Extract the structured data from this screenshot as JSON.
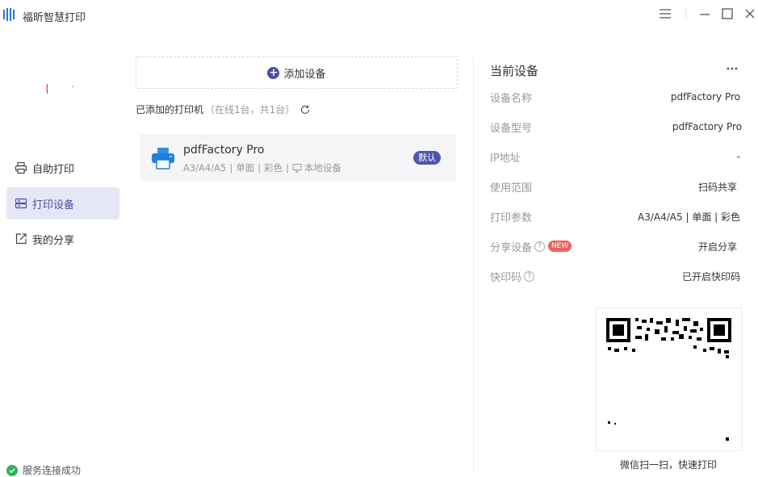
{
  "app": {
    "title": "福昕智慧打印",
    "brand_color": "#2b6fe0",
    "accent": "#4a4ea8"
  },
  "sidebar": {
    "items": [
      {
        "label": "自助打印",
        "icon": "printer-icon",
        "active": false
      },
      {
        "label": "打印设备",
        "icon": "device-icon",
        "active": true
      },
      {
        "label": "我的分享",
        "icon": "share-icon",
        "active": false
      }
    ],
    "status": "服务连接成功",
    "status_color": "#35b35b"
  },
  "main": {
    "add_device_label": "添加设备",
    "added_title": "已添加的打印机",
    "added_sub": "（在线1台，共1台）",
    "printers": [
      {
        "name": "pdfFactory Pro",
        "sizes": "A3/A4/A5",
        "sep1": "|",
        "duplex": "单面",
        "sep2": "|",
        "color": "彩色",
        "sep3": "|",
        "location": "本地设备",
        "badge": "默认"
      }
    ]
  },
  "current_device": {
    "title": "当前设备",
    "fields": [
      {
        "key": "设备名称",
        "value": "pdfFactory Pro"
      },
      {
        "key": "设备型号",
        "value": "pdfFactory Pro"
      },
      {
        "key": "IP地址",
        "value": "-"
      },
      {
        "key": "使用范围",
        "value": "扫码共享"
      },
      {
        "key": "打印参数",
        "value": "A3/A4/A5 | 单面 | 彩色"
      },
      {
        "key": "分享设备",
        "value": "开启分享",
        "help": "?",
        "badge": "NEW"
      },
      {
        "key": "快印码",
        "value": "已开启快印码",
        "help": "?"
      }
    ],
    "qr_caption": "微信扫一扫，快速打印"
  }
}
